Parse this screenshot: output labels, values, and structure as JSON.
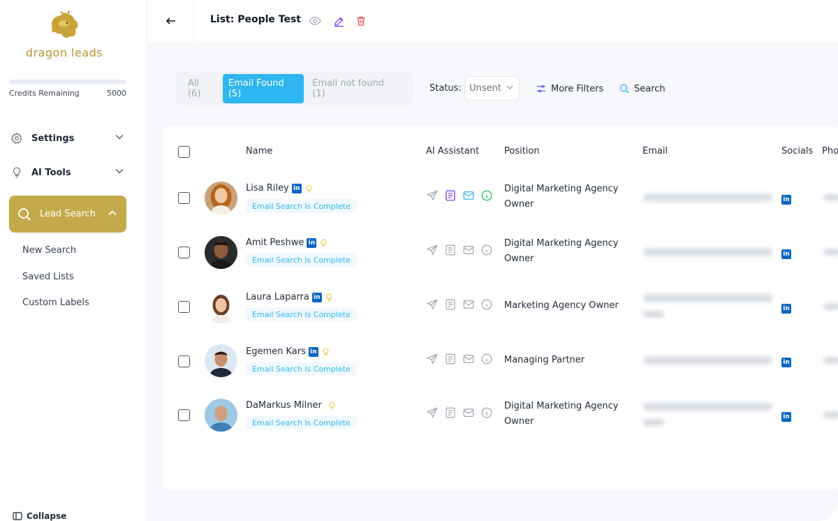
{
  "brand": {
    "name": "dragon leads",
    "accent": "#c5aa4c",
    "primary": "#2eb6f0"
  },
  "sidebar": {
    "credits_label": "Credits Remaining",
    "credits_value": "5000",
    "items": [
      {
        "label": "Settings",
        "icon": "gear-icon"
      },
      {
        "label": "AI Tools",
        "icon": "lightbulb-icon"
      },
      {
        "label": "Lead Search",
        "icon": "search-icon",
        "active": true
      }
    ],
    "sub_items": [
      "New Search",
      "Saved Lists",
      "Custom Labels"
    ],
    "collapse_label": "Collapse"
  },
  "header": {
    "title": "List: People Test"
  },
  "filters": {
    "tabs": [
      "All (6)",
      "Email Found (5)",
      "Email not found (1)"
    ],
    "active_tab": "Email Found (5)",
    "status_label": "Status:",
    "status_value": "Unsent",
    "more_filters": "More Filters",
    "search": "Search"
  },
  "table": {
    "columns": [
      "Name",
      "AI Assistant",
      "Position",
      "Email",
      "Socials",
      "Pho"
    ],
    "rows": [
      {
        "name": "Lisa Riley",
        "linkedin": true,
        "badge": "Email Search Is Complete",
        "position": "Digital Marketing Agency Owner"
      },
      {
        "name": "Amit Peshwe",
        "linkedin": true,
        "badge": "Email Search Is Complete",
        "position": "Digital Marketing Agency Owner"
      },
      {
        "name": "Laura Laparra",
        "linkedin": true,
        "badge": "Email Search Is Complete",
        "position": "Marketing Agency Owner"
      },
      {
        "name": "Egemen Kars",
        "linkedin": true,
        "badge": "Email Search Is Complete",
        "position": "Managing Partner"
      },
      {
        "name": "DaMarkus Milner",
        "linkedin": false,
        "badge": "Email Search Is Complete",
        "position": "Digital Marketing Agency Owner"
      }
    ]
  }
}
